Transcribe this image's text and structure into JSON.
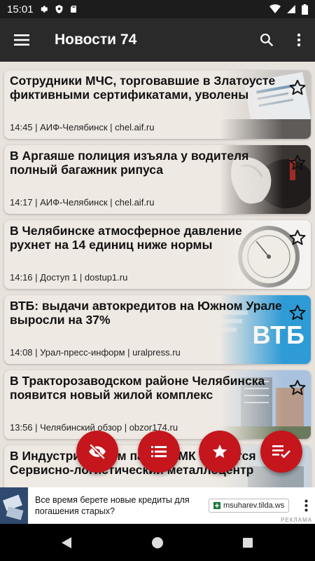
{
  "status_bar": {
    "time": "15:01"
  },
  "app_bar": {
    "title": "Новости 74"
  },
  "cards": [
    {
      "title": "Сотрудники МЧС, торговавшие в Златоусте фиктивными сертификатами, уволены",
      "time": "14:45",
      "source": "АИФ-Челябинск",
      "domain": "chel.aif.ru",
      "meta": "14:45  | АИФ-Челябинск | chel.aif.ru",
      "image": "certificate-photo",
      "starred": false
    },
    {
      "title": "В Аргаяше полиция изъяла у водителя полный багажник рипуса",
      "time": "14:17",
      "source": "АИФ-Челябинск",
      "domain": "chel.aif.ru",
      "meta": "14:17  | АИФ-Челябинск | chel.aif.ru",
      "image": "fish-bag-photo",
      "starred": false
    },
    {
      "title": "В Челябинске атмосферное давление рухнет на 14 единиц ниже нормы",
      "time": "14:16",
      "source": "Доступ 1",
      "domain": "dostup1.ru",
      "meta": "14:16  | Доступ 1 | dostup1.ru",
      "image": "barometer-photo",
      "starred": false
    },
    {
      "title": "ВТБ: выдачи автокредитов на Южном Урале выросли на 37%",
      "time": "14:08",
      "source": "Урал-пресс-информ",
      "domain": "uralpress.ru",
      "meta": "14:08  | Урал-пресс-информ | uralpress.ru",
      "image": "vtb-logo",
      "logo_text": "ВТБ",
      "starred": false
    },
    {
      "title": "В Тракторозаводском районе Челябинска появится новый жилой комплекс",
      "time": "13:56",
      "source": "Челябинский обзор",
      "domain": "obzor174.ru",
      "meta": "13:56  | Челябинский обзор | obzor174.ru",
      "image": "buildings-photo",
      "starred": false
    },
    {
      "title": "В Индустриальном парке ММК появится Сервисно-логистический металлоцентр",
      "meta": "",
      "image": "industrial-photo",
      "starred": false
    }
  ],
  "fabs": [
    {
      "name": "hide-read-fab",
      "icon": "eye-off-icon"
    },
    {
      "name": "list-fab",
      "icon": "list-icon"
    },
    {
      "name": "favorites-fab",
      "icon": "star-icon"
    },
    {
      "name": "mark-read-fab",
      "icon": "playlist-check-icon"
    }
  ],
  "ad": {
    "text": "Все время берете новые кредиты для погашения старых?",
    "link": "msuharev.tilda.ws",
    "label": "РЕКЛАМА"
  },
  "colors": {
    "accent": "#c4161c",
    "app_bar": "#2a2a2a",
    "status_bar": "#1c1c1c",
    "background": "#e8e2dc"
  }
}
